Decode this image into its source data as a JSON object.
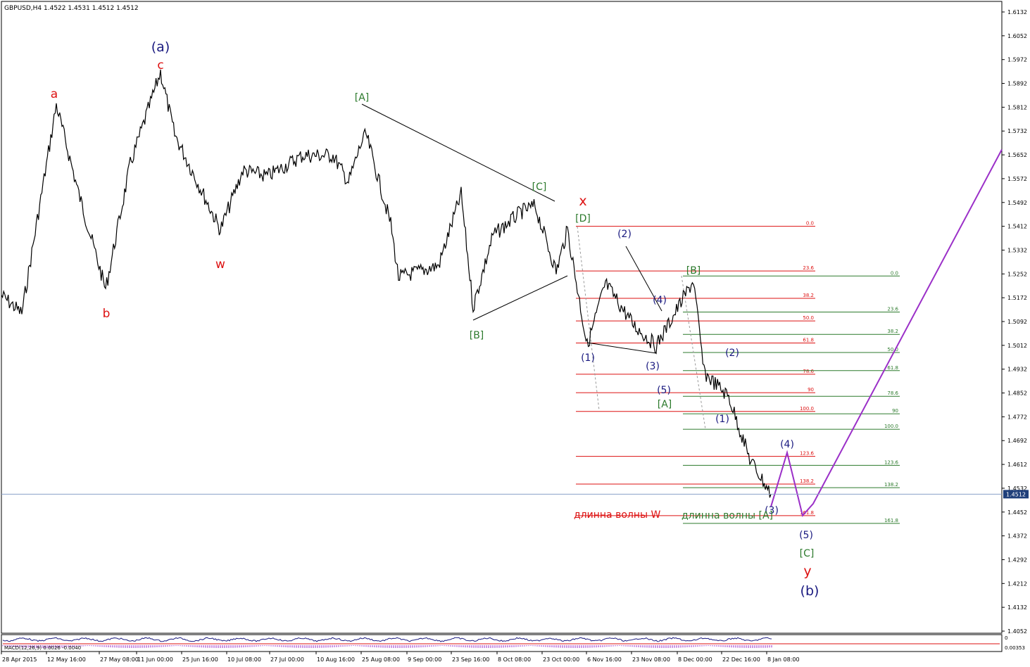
{
  "header": {
    "symbol_info": "GBPUSD,H4  1.4522 1.4531 1.4512 1.4512"
  },
  "price_axis": {
    "ticks": [
      "1.6132",
      "1.6052",
      "1.5972",
      "1.5892",
      "1.5812",
      "1.5732",
      "1.5652",
      "1.5572",
      "1.5492",
      "1.5412",
      "1.5332",
      "1.5252",
      "1.5172",
      "1.5092",
      "1.5012",
      "1.4932",
      "1.4852",
      "1.4772",
      "1.4692",
      "1.4612",
      "1.4532",
      "1.4452",
      "1.4372",
      "1.4292",
      "1.4212",
      "1.4132",
      "1.4052"
    ],
    "current_price": "1.4512",
    "current_price_bg": "#1f3f7a"
  },
  "time_axis": {
    "ticks": [
      "28 Apr 2015",
      "12 May 16:00",
      "27 May 08:00",
      "11 Jun 00:00",
      "25 Jun 16:00",
      "10 Jul 08:00",
      "27 Jul 00:00",
      "10 Aug 16:00",
      "25 Aug 08:00",
      "9 Sep 00:00",
      "23 Sep 16:00",
      "8 Oct 08:00",
      "23 Oct 00:00",
      "6 Nov 16:00",
      "23 Nov 08:00",
      "8 Dec 00:00",
      "22 Dec 16:00",
      "8 Jan 08:00"
    ]
  },
  "indicator": {
    "ma_text": "MACD(12,26,9) 0.0026 -0.0040",
    "axis_top": "0",
    "axis_bottom": "0.00353"
  },
  "colors": {
    "red": "#dd1111",
    "green": "#2c7a2c",
    "navy": "#1a1a80",
    "purple": "#9b30c8",
    "candles": "#000000"
  },
  "wave_labels": {
    "a_navy": "(a)",
    "c_red": "c",
    "a_red": "a",
    "b_red": "b",
    "w_red": "w",
    "A_green": "[A]",
    "B_green": "[B]",
    "C_green": "[C]",
    "D_green": "[D]",
    "x_red": "x",
    "p2_1": "(2)",
    "p4_1": "(4)",
    "p1_1": "(1)",
    "p3_1": "(3)",
    "p5_1": "(5)",
    "A2_green": "[A]",
    "B2_green": "[B]",
    "p2_2": "(2)",
    "p1_2": "(1)",
    "p4_2": "(4)",
    "p3_2": "(3)",
    "p5_2": "(5)",
    "C2_green": "[C]",
    "y_red": "y",
    "b_navy": "(b)"
  },
  "fib_w": {
    "caption": "длинна волны W",
    "levels": [
      "0.0",
      "23.6",
      "38.2",
      "50.0",
      "61.8",
      "78.6",
      "90",
      "100.0",
      "123.6",
      "138.2",
      "161.8"
    ],
    "prices": [
      1.5412,
      1.5262,
      1.517,
      1.5094,
      1.502,
      1.4915,
      1.4853,
      1.479,
      1.4639,
      1.4546,
      1.444
    ]
  },
  "fib_A": {
    "caption": "длинна волны [A]",
    "levels": [
      "0.0",
      "23.6",
      "38.2",
      "50.0",
      "61.8",
      "78.6",
      "90",
      "100.0",
      "123.6",
      "138.2",
      "161.8"
    ],
    "prices": [
      1.5245,
      1.5124,
      1.5049,
      1.4988,
      1.4927,
      1.4841,
      1.4782,
      1.473,
      1.4609,
      1.4534,
      1.4414
    ]
  },
  "chart_data": {
    "type": "line",
    "title": "GBPUSD,H4",
    "ylim": [
      1.4,
      1.616
    ],
    "ohlc_last": {
      "open": 1.4522,
      "high": 1.4531,
      "low": 1.4512,
      "close": 1.4512
    },
    "series": [
      {
        "name": "GBPUSD",
        "x": [
          "28 Apr 2015",
          "5 May",
          "12 May",
          "20 May",
          "27 May",
          "4 Jun",
          "11 Jun",
          "18 Jun",
          "25 Jun",
          "3 Jul",
          "10 Jul",
          "18 Jul",
          "27 Jul",
          "3 Aug",
          "10 Aug",
          "18 Aug",
          "25 Aug",
          "1 Sep",
          "9 Sep",
          "16 Sep",
          "23 Sep",
          "30 Sep",
          "8 Oct",
          "15 Oct",
          "23 Oct",
          "30 Oct",
          "6 Nov",
          "14 Nov",
          "23 Nov",
          "1 Dec",
          "8 Dec",
          "15 Dec",
          "22 Dec",
          "30 Dec",
          "8 Jan"
        ],
        "y": [
          1.518,
          1.512,
          1.582,
          1.552,
          1.52,
          1.562,
          1.593,
          1.572,
          1.54,
          1.56,
          1.558,
          1.565,
          1.565,
          1.556,
          1.569,
          1.572,
          1.542,
          1.524,
          1.528,
          1.552,
          1.514,
          1.538,
          1.546,
          1.548,
          1.526,
          1.54,
          1.501,
          1.522,
          1.508,
          1.501,
          1.523,
          1.492,
          1.484,
          1.463,
          1.4512
        ]
      },
      {
        "name": "projection",
        "x": [
          "8 Jan",
          "11 Jan",
          "13 Jan",
          "15 Jan",
          "2 Mar"
        ],
        "y": [
          1.447,
          1.4652,
          1.444,
          1.448,
          1.567
        ]
      }
    ]
  }
}
